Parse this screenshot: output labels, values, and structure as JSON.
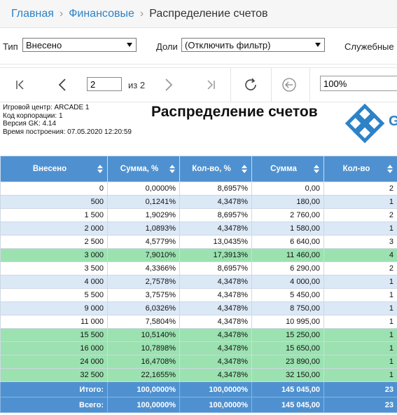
{
  "breadcrumb": {
    "items": [
      "Главная",
      "Финансовые"
    ],
    "current": "Распределение счетов"
  },
  "filters": {
    "type_label": "Тип",
    "type_value": "Внесено",
    "share_label": "Доли",
    "share_value": "(Отключить фильтр)",
    "service_label": "Служебные"
  },
  "toolbar": {
    "page_value": "2",
    "page_of": "из 2",
    "zoom_value": "100%"
  },
  "report": {
    "meta_lines": [
      "Игровой центр: ARCADE 1",
      "Код корпорации: 1",
      "Версия GK: 4.14",
      "Время построения: 07.05.2020 12:20:59"
    ],
    "title": "Распределение счетов",
    "logo_letter": "G"
  },
  "table": {
    "columns": [
      "Внесено",
      "Сумма, %",
      "Кол-во, %",
      "Сумма",
      "Кол-во"
    ],
    "rows": [
      {
        "style": "white",
        "cells": [
          "0",
          "0,0000%",
          "8,6957%",
          "0,00",
          "2"
        ]
      },
      {
        "style": "blue",
        "cells": [
          "500",
          "0,1241%",
          "4,3478%",
          "180,00",
          "1"
        ]
      },
      {
        "style": "white",
        "cells": [
          "1 500",
          "1,9029%",
          "8,6957%",
          "2 760,00",
          "2"
        ]
      },
      {
        "style": "blue",
        "cells": [
          "2 000",
          "1,0893%",
          "4,3478%",
          "1 580,00",
          "1"
        ]
      },
      {
        "style": "white",
        "cells": [
          "2 500",
          "4,5779%",
          "13,0435%",
          "6 640,00",
          "3"
        ]
      },
      {
        "style": "green",
        "cells": [
          "3 000",
          "7,9010%",
          "17,3913%",
          "11 460,00",
          "4"
        ]
      },
      {
        "style": "white",
        "cells": [
          "3 500",
          "4,3366%",
          "8,6957%",
          "6 290,00",
          "2"
        ]
      },
      {
        "style": "blue",
        "cells": [
          "4 000",
          "2,7578%",
          "4,3478%",
          "4 000,00",
          "1"
        ]
      },
      {
        "style": "white",
        "cells": [
          "5 500",
          "3,7575%",
          "4,3478%",
          "5 450,00",
          "1"
        ]
      },
      {
        "style": "blue",
        "cells": [
          "9 000",
          "6,0326%",
          "4,3478%",
          "8 750,00",
          "1"
        ]
      },
      {
        "style": "white",
        "cells": [
          "11 000",
          "7,5804%",
          "4,3478%",
          "10 995,00",
          "1"
        ]
      },
      {
        "style": "green",
        "cells": [
          "15 500",
          "10,5140%",
          "4,3478%",
          "15 250,00",
          "1"
        ]
      },
      {
        "style": "green",
        "cells": [
          "16 000",
          "10,7898%",
          "4,3478%",
          "15 650,00",
          "1"
        ]
      },
      {
        "style": "green",
        "cells": [
          "24 000",
          "16,4708%",
          "4,3478%",
          "23 890,00",
          "1"
        ]
      },
      {
        "style": "green",
        "cells": [
          "32 500",
          "22,1655%",
          "4,3478%",
          "32 150,00",
          "1"
        ]
      },
      {
        "style": "total",
        "cells": [
          "Итого:",
          "100,0000%",
          "100,0000%",
          "145 045,00",
          "23"
        ]
      },
      {
        "style": "total",
        "cells": [
          "Всего:",
          "100,0000%",
          "100,0000%",
          "145 045,00",
          "23"
        ]
      }
    ]
  },
  "colors": {
    "header_blue": "#4f91d0",
    "row_blue": "#dbe8f6",
    "row_green": "#9be2b0",
    "link_blue": "#2e82c6"
  }
}
